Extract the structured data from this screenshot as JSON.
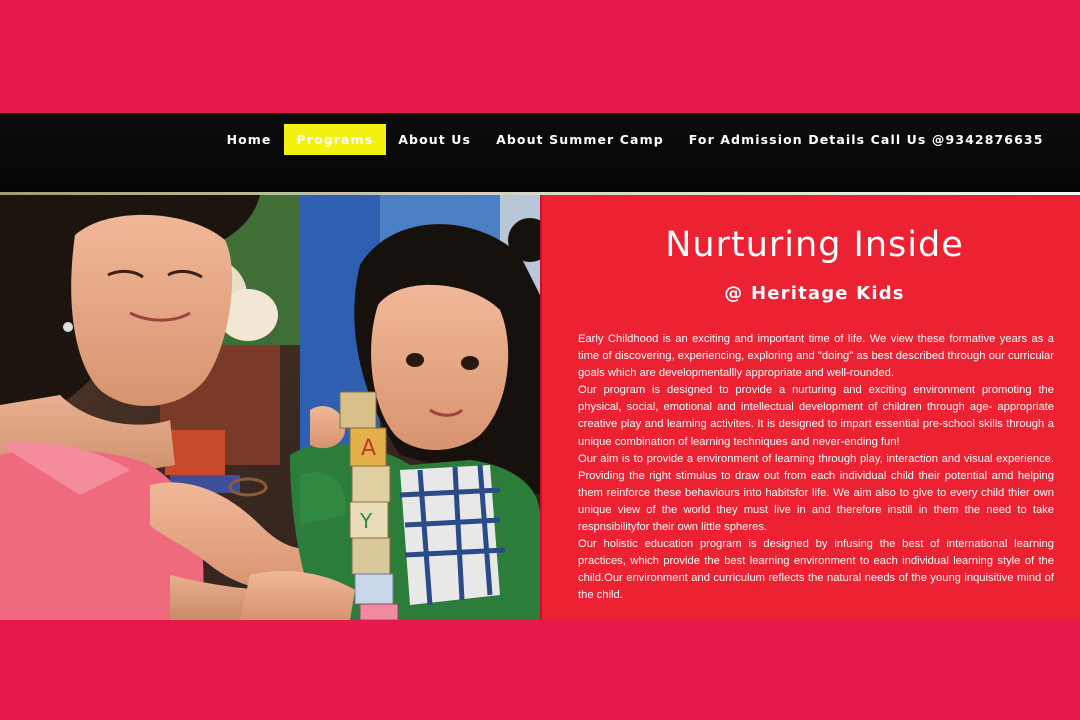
{
  "nav": {
    "items": [
      {
        "label": "Home",
        "active": false
      },
      {
        "label": "Programs",
        "active": true
      },
      {
        "label": "About Us",
        "active": false
      },
      {
        "label": "About Summer Camp",
        "active": false
      },
      {
        "label": "For Admission Details Call Us @9342876635",
        "active": false
      }
    ]
  },
  "hero": {
    "image": "woman and child stacking alphabet blocks"
  },
  "content": {
    "title": "Nurturing Inside",
    "subtitle": "@ Heritage Kids",
    "paragraphs": [
      "Early Childhood is an exciting and important time of life. We view these formative years as a time of discovering, experiencing, exploring and \"doing\" as best described through our curricular goals which are developmentallly appropriate and well-rounded.",
      "Our program is designed to provide a nurturing and exciting environment promoting the physical, social, emotional and intellectual development of children through age- appropriate creative play and learning activites. It is designed to impart essential pre-school skills through a unique combination of learning techniques and never-ending fun!",
      "Our aim is to provide a environment of learning through play, interaction and visual experience. Providing the right stimulus to draw out from each individual child their potential amd helping them reinforce these behaviours into habitsfor life. We aim also to give to every child thier own unique view of the world they must live in and therefore instill in them the need to take respnsibilityfor their own little spheres.",
      "Our holistic education program is designed by infusing the best of international learning practices, which provide the best learning environment to each individual learning style of the child.Our environment and curriculum reflects the natural needs of the young inquisitive mind of the child."
    ]
  },
  "colors": {
    "page_band": "#e5194b",
    "navbar": "#0a0a0a",
    "active_nav": "#f2f20e",
    "content_panel": "#ec2233"
  }
}
